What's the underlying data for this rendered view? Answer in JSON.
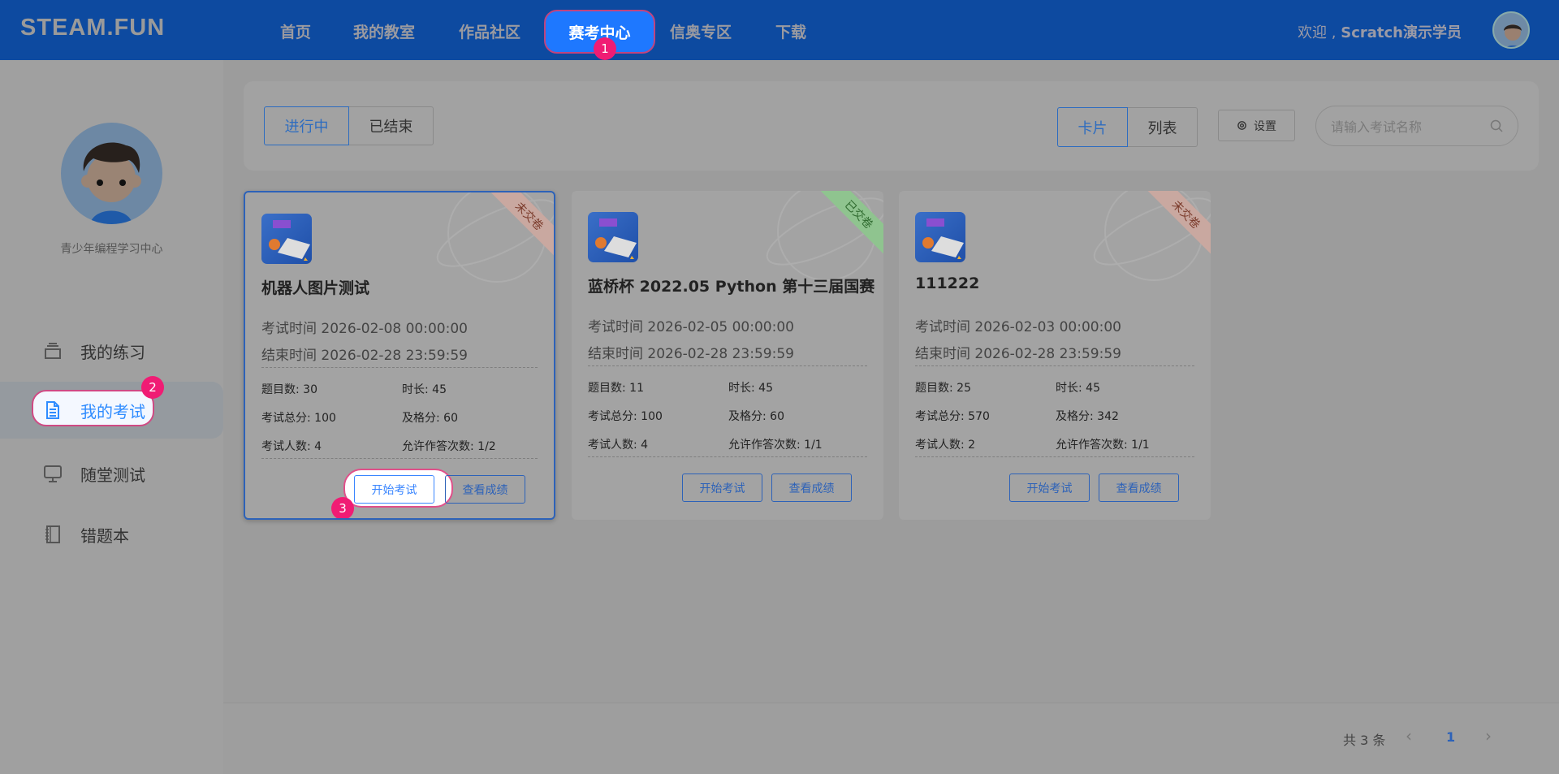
{
  "header": {
    "logo": "STEAM.FUN",
    "nav": [
      "首页",
      "我的教室",
      "作品社区",
      "赛考中心",
      "信奥专区",
      "下载"
    ],
    "active_nav": "赛考中心",
    "welcome_prefix": "欢迎 ,",
    "user_name": "Scratch演示学员"
  },
  "step_badges": [
    "1",
    "2",
    "3"
  ],
  "sidebar": {
    "org_name": "青少年编程学习中心",
    "items": [
      {
        "label": "我的练习",
        "icon": "layers-icon"
      },
      {
        "label": "我的考试",
        "icon": "document-icon",
        "active": true
      },
      {
        "label": "随堂测试",
        "icon": "monitor-icon"
      },
      {
        "label": "错题本",
        "icon": "notebook-icon"
      }
    ]
  },
  "toolbar": {
    "status_tabs": [
      "进行中",
      "已结束"
    ],
    "view_tabs": [
      "卡片",
      "列表"
    ],
    "settings_label": "设置",
    "search_placeholder": "请输入考试名称"
  },
  "cards": [
    {
      "title": "机器人图片测试",
      "ribbon": "未交卷",
      "start": "考试时间 2026-02-08 00:00:00",
      "end": "结束时间 2026-02-28 23:59:59",
      "questions": "题目数: 30",
      "duration": "时长: 45",
      "total": "考试总分: 100",
      "pass": "及格分: 60",
      "people": "考试人数: 4",
      "attempts": "允许作答次数: 1/2",
      "start_btn": "开始考试",
      "score_btn": "查看成绩"
    },
    {
      "title": "蓝桥杯 2022.05 Python 第十三届国赛",
      "ribbon": "已交卷",
      "start": "考试时间 2026-02-05 00:00:00",
      "end": "结束时间 2026-02-28 23:59:59",
      "questions": "题目数: 11",
      "duration": "时长: 45",
      "total": "考试总分: 100",
      "pass": "及格分: 60",
      "people": "考试人数: 4",
      "attempts": "允许作答次数: 1/1",
      "start_btn": "开始考试",
      "score_btn": "查看成绩"
    },
    {
      "title": "111222",
      "ribbon": "未交卷",
      "start": "考试时间 2026-02-03 00:00:00",
      "end": "结束时间 2026-02-28 23:59:59",
      "questions": "题目数: 25",
      "duration": "时长: 45",
      "total": "考试总分: 570",
      "pass": "及格分: 342",
      "people": "考试人数: 2",
      "attempts": "允许作答次数: 1/1",
      "start_btn": "开始考试",
      "score_btn": "查看成绩"
    }
  ],
  "pagination": {
    "total": "共 3 条",
    "prev": "‹",
    "current": "1",
    "next": "›"
  },
  "colors": {
    "header": "#0d4aa0",
    "accent": "#1e78ff",
    "badge": "#f01c74",
    "ribbon_pending": "#c9a8a0",
    "ribbon_done": "#8fc48f"
  }
}
